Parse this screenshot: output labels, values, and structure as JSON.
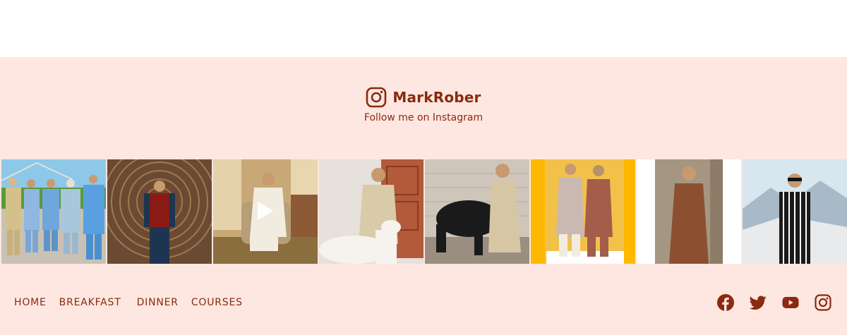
{
  "instagram": {
    "handle": "MarkRober",
    "subtitle": "Follow me on Instagram",
    "icon": "instagram-icon"
  },
  "photos": [
    {
      "name": "group-photo",
      "has_play": false
    },
    {
      "name": "man-red-vest-photo",
      "has_play": false
    },
    {
      "name": "man-seated-video",
      "has_play": true
    },
    {
      "name": "man-with-lamb-photo",
      "has_play": false
    },
    {
      "name": "man-with-buffalo-photo",
      "has_play": false
    },
    {
      "name": "two-men-yellow-wall-photo",
      "has_play": false
    },
    {
      "name": "man-brown-suit-photo",
      "has_play": false
    },
    {
      "name": "man-striped-shirt-photo",
      "has_play": false
    }
  ],
  "nav": {
    "items": [
      "HOME",
      "BREAKFAST",
      "DINNER",
      "COURSES"
    ]
  },
  "socials": [
    "facebook-icon",
    "twitter-icon",
    "youtube-icon",
    "instagram-icon"
  ],
  "colors": {
    "footer_bg": "#fde7e0",
    "accent": "#8a2a10"
  }
}
